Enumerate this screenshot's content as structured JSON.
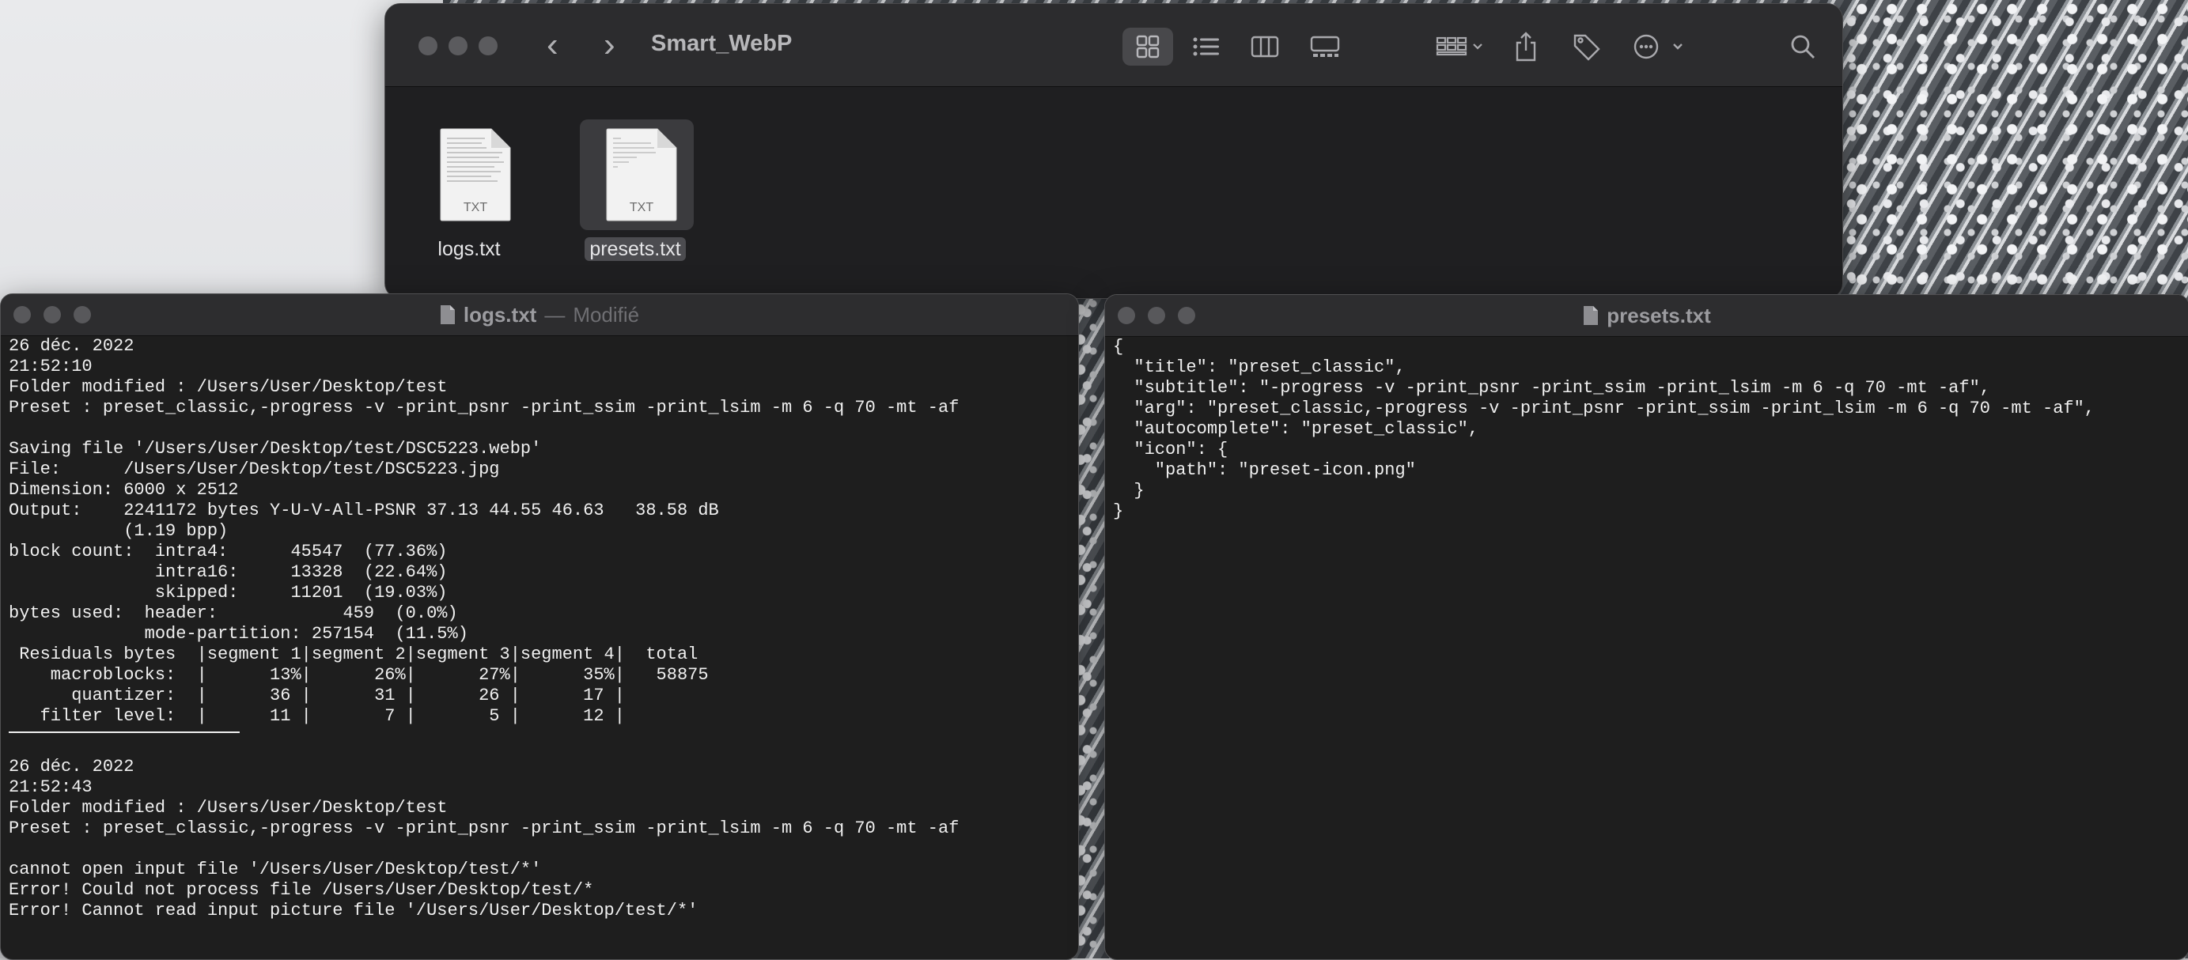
{
  "finder": {
    "title": "Smart_WebP",
    "files": [
      {
        "name": "logs.txt",
        "type_label": "TXT",
        "selected": false
      },
      {
        "name": "presets.txt",
        "type_label": "TXT",
        "selected": true
      }
    ],
    "toolbar_icons": [
      "back-icon",
      "forward-icon",
      "icon-view-icon",
      "list-view-icon",
      "column-view-icon",
      "gallery-view-icon",
      "group-icon",
      "share-icon",
      "tag-icon",
      "more-icon",
      "search-icon"
    ],
    "nav": {
      "back": "‹",
      "forward": "›"
    }
  },
  "logs_window": {
    "title": "logs.txt",
    "separator": "—",
    "status": "Modifié",
    "lines_block1": "26 déc. 2022\n21:52:10\nFolder modified : /Users/User/Desktop/test\nPreset : preset_classic,-progress -v -print_psnr -print_ssim -print_lsim -m 6 -q 70 -mt -af\n\nSaving file '/Users/User/Desktop/test/DSC5223.webp'\nFile:      /Users/User/Desktop/test/DSC5223.jpg\nDimension: 6000 x 2512\nOutput:    2241172 bytes Y-U-V-All-PSNR 37.13 44.55 46.63   38.58 dB\n           (1.19 bpp)\nblock count:  intra4:      45547  (77.36%)\n              intra16:     13328  (22.64%)\n              skipped:     11201  (19.03%)\nbytes used:  header:            459  (0.0%)\n             mode-partition: 257154  (11.5%)\n Residuals bytes  |segment 1|segment 2|segment 3|segment 4|  total\n    macroblocks:  |      13%|      26%|      27%|      35%|   58875\n      quantizer:  |      36 |      31 |      26 |      17 |\n   filter level:  |      11 |       7 |       5 |      12 |\n",
    "lines_block2": "26 déc. 2022\n21:52:43\nFolder modified : /Users/User/Desktop/test\nPreset : preset_classic,-progress -v -print_psnr -print_ssim -print_lsim -m 6 -q 70 -mt -af\n\ncannot open input file '/Users/User/Desktop/test/*'\nError! Could not process file /Users/User/Desktop/test/*\nError! Cannot read input picture file '/Users/User/Desktop/test/*'"
  },
  "presets_window": {
    "title": "presets.txt",
    "content": "{\n  \"title\": \"preset_classic\",\n  \"subtitle\": \"-progress -v -print_psnr -print_ssim -print_lsim -m 6 -q 70 -mt -af\",\n  \"arg\": \"preset_classic,-progress -v -print_psnr -print_ssim -print_lsim -m 6 -q 70 -mt -af\",\n  \"autocomplete\": \"preset_classic\",\n  \"icon\": {\n    \"path\": \"preset-icon.png\"\n  }\n}"
  }
}
